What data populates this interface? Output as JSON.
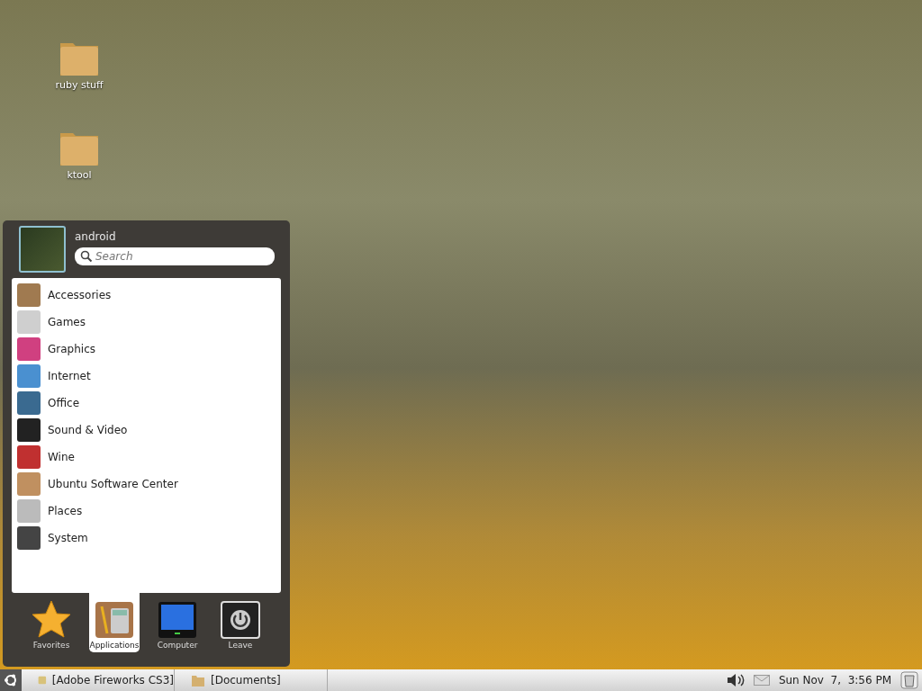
{
  "desktop_icons": [
    {
      "label": "ruby stuff"
    },
    {
      "label": "ktool"
    }
  ],
  "menu": {
    "user": "android",
    "search": {
      "placeholder": "Search"
    },
    "categories": [
      {
        "label": "Accessories"
      },
      {
        "label": "Games"
      },
      {
        "label": "Graphics"
      },
      {
        "label": "Internet"
      },
      {
        "label": "Office"
      },
      {
        "label": "Sound & Video"
      },
      {
        "label": "Wine"
      },
      {
        "label": "Ubuntu Software Center"
      },
      {
        "label": "Places"
      },
      {
        "label": "System"
      }
    ],
    "tabs": [
      {
        "label": "Favorites",
        "kind": "star",
        "selected": false
      },
      {
        "label": "Applications",
        "kind": "apps",
        "selected": true
      },
      {
        "label": "Computer",
        "kind": "monitor",
        "selected": false
      },
      {
        "label": "Leave",
        "kind": "power",
        "selected": false
      }
    ]
  },
  "taskbar": {
    "tasks": [
      {
        "label": "[Adobe Fireworks CS3]",
        "kind": "app"
      },
      {
        "label": "[Documents]",
        "kind": "folder"
      }
    ],
    "clock": "Sun Nov  7,  3:56 PM"
  }
}
